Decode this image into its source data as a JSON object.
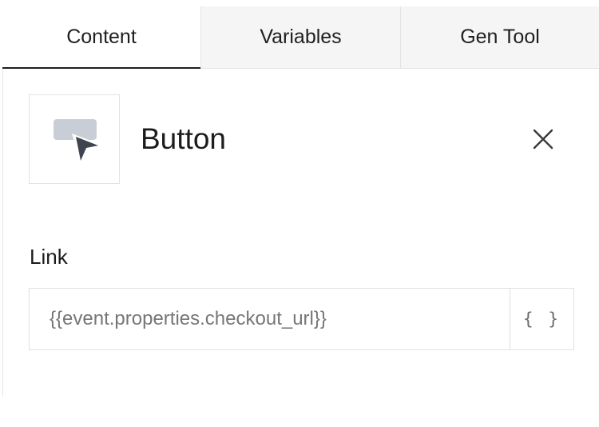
{
  "tabs": [
    {
      "label": "Content",
      "active": true
    },
    {
      "label": "Variables",
      "active": false
    },
    {
      "label": "Gen Tool",
      "active": false
    }
  ],
  "block": {
    "title": "Button",
    "icon": "button-cursor-icon",
    "close_icon": "close-icon"
  },
  "link_field": {
    "label": "Link",
    "value": "{{event.properties.checkout_url}}",
    "variable_button_glyph": "{ }"
  },
  "colors": {
    "active_tab_underline": "#1f1f1f",
    "inactive_tab_bg": "#f5f5f5",
    "icon_gray": "#c9ced6",
    "icon_dark": "#3f454f"
  }
}
